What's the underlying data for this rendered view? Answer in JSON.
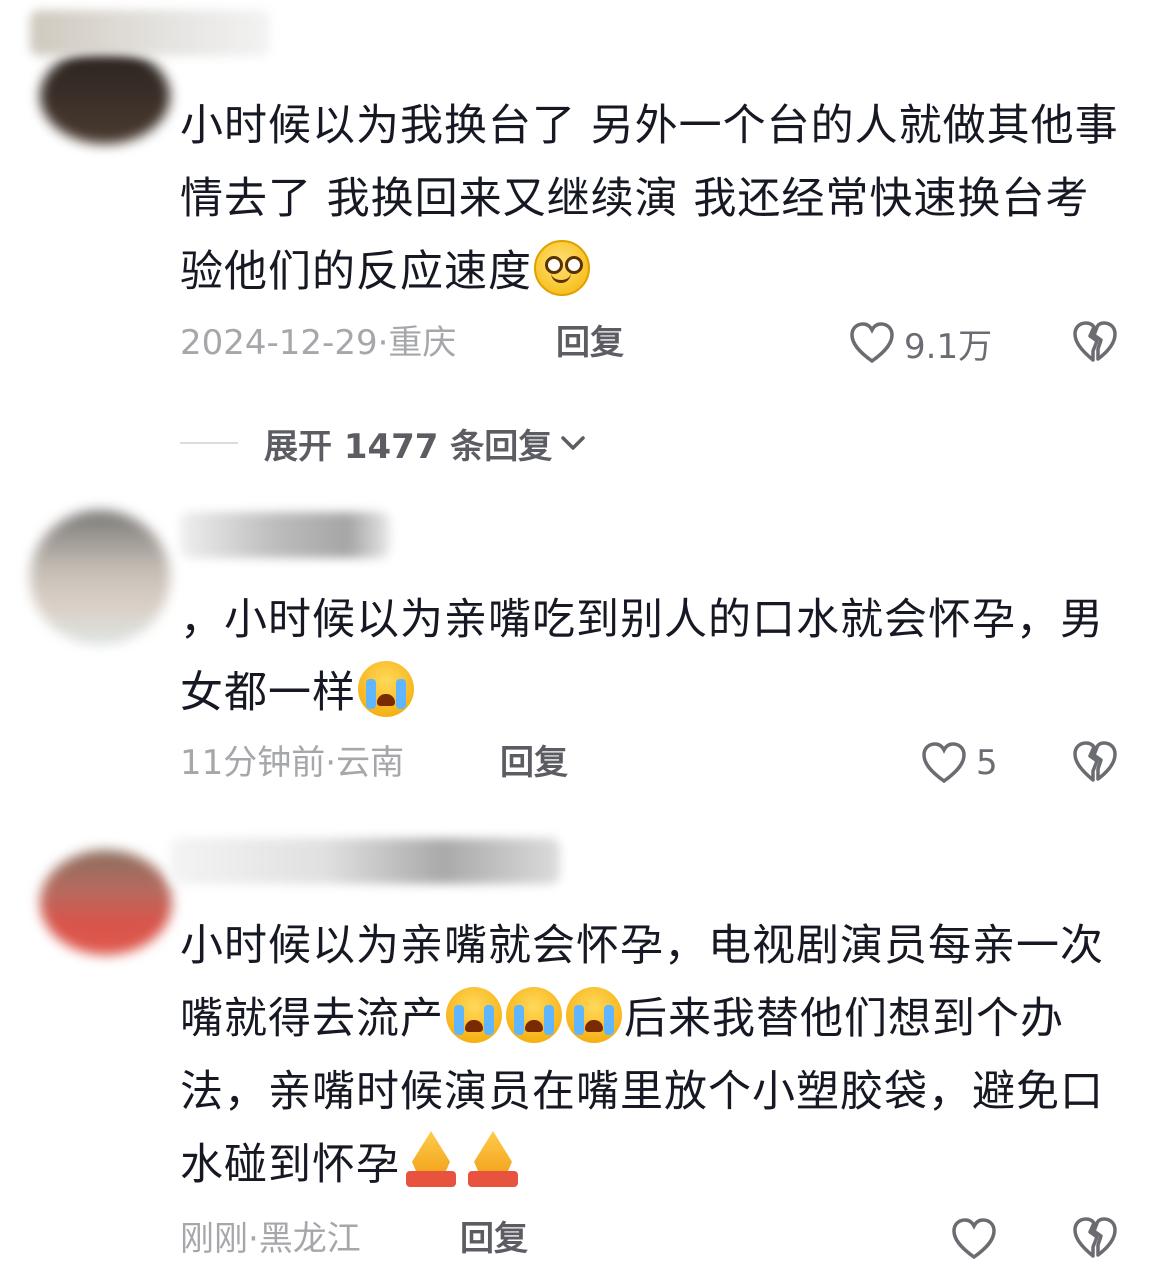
{
  "comments": [
    {
      "text": "小时候以为我换台了 另外一个台的人就做其他事情去了 我换回来又继续演 我还经常快速换台考验他们的反应速度",
      "emojis": [
        "flushed-smile"
      ],
      "date": "2024-12-29",
      "location": "重庆",
      "reply_label": "回复",
      "likes": "9.1万"
    },
    {
      "text": "，小时候以为亲嘴吃到别人的口水就会怀孕，男女都一样",
      "emojis": [
        "crying"
      ],
      "date": "11分钟前",
      "location": "云南",
      "reply_label": "回复",
      "likes": "5"
    },
    {
      "text_a": "小时候以为亲嘴就会怀孕，电视剧演员每亲一次嘴就得去流产",
      "text_b": "后来我替他们想到个办法，亲嘴时候演员在嘴里放个小塑胶袋，避免口水碰到怀孕",
      "emojis": [
        "crying",
        "crying",
        "crying",
        "praying",
        "praying"
      ],
      "date": "刚刚",
      "location": "黑龙江",
      "reply_label": "回复",
      "likes": ""
    }
  ],
  "expand_replies": "展开 1477 条回复",
  "separator": "·",
  "icons": [
    "heart-outline-icon",
    "broken-heart-icon",
    "chevron-down-icon"
  ]
}
